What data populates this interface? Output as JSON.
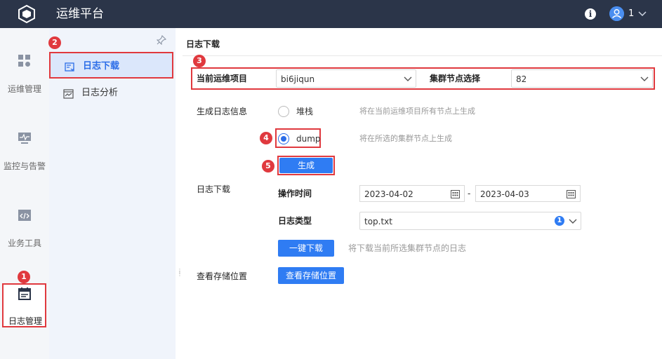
{
  "header": {
    "app_title": "运维平台",
    "info_icon": "info-icon",
    "user_name": "1"
  },
  "rail": {
    "items": [
      {
        "label": "运维管理",
        "icon": "dashboard-grid-icon"
      },
      {
        "label": "监控与告警",
        "icon": "monitor-icon"
      },
      {
        "label": "业务工具",
        "icon": "code-window-icon"
      },
      {
        "label": "日志管理",
        "icon": "log-calendar-icon",
        "active": true
      }
    ]
  },
  "subnav": {
    "items": [
      {
        "label": "日志下载",
        "icon": "log-download-icon",
        "active": true
      },
      {
        "label": "日志分析",
        "icon": "log-analysis-icon"
      }
    ]
  },
  "main": {
    "page_title": "日志下载",
    "project_label": "当前运维项目",
    "project_value": "bi6jiqun",
    "node_label": "集群节点选择",
    "node_value": "82",
    "gen_info_label": "生成日志信息",
    "options": [
      {
        "label": "堆栈",
        "hint": "将在当前运维项目所有节点上生成",
        "checked": false
      },
      {
        "label": "dump",
        "hint": "将在所选的集群节点上生成",
        "checked": true
      }
    ],
    "generate_button": "生成",
    "download_section_label": "日志下载",
    "op_time_label": "操作时间",
    "date_start": "2023-04-02",
    "date_sep": "-",
    "date_end": "2023-04-03",
    "log_type_label": "日志类型",
    "log_type_value": "top.txt",
    "log_type_count": "1",
    "one_click_download": "一键下载",
    "download_hint": "将下载当前所选集群节点的日志",
    "storage_label": "查看存储位置",
    "storage_button": "查看存储位置"
  },
  "annotations": [
    "1",
    "2",
    "3",
    "4",
    "5"
  ],
  "colors": {
    "topbar": "#2b3549",
    "accent": "#2f7cf3",
    "annotation_red": "#e0393e"
  }
}
